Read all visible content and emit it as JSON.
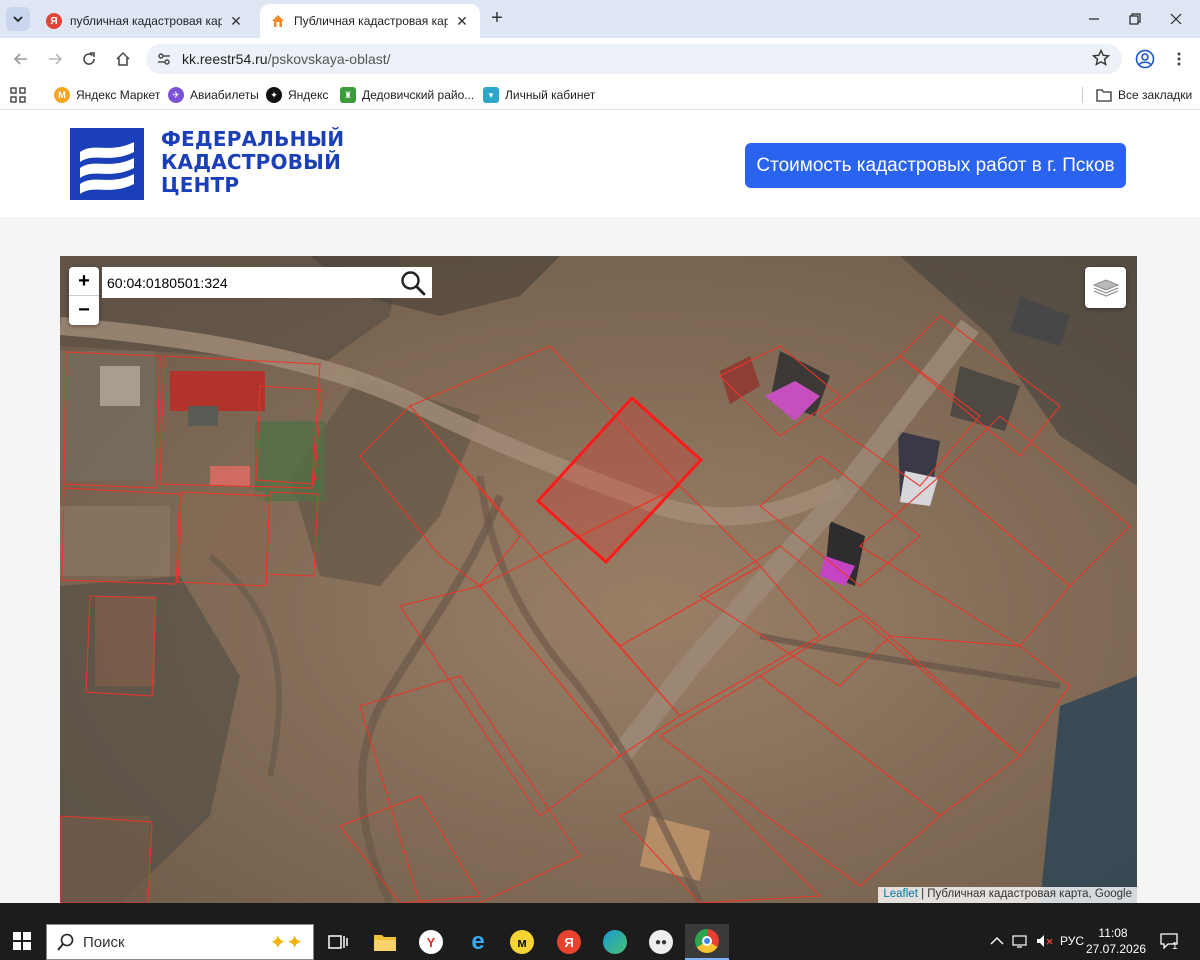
{
  "browser": {
    "tabs": [
      {
        "title": "публичная кадастровая карта",
        "favicon": "yandex-icon",
        "active": false
      },
      {
        "title": "Публичная кадастровая карта",
        "favicon": "house-icon",
        "active": true
      }
    ],
    "new_tab_label": "+",
    "address": {
      "host": "kk.reestr54.ru",
      "path": "/pskovskaya-oblast/"
    }
  },
  "bookmarks": {
    "items": [
      {
        "label": "Яндекс Маркет",
        "icon": "yandex-market-icon"
      },
      {
        "label": "Авиабилеты",
        "icon": "airplane-icon"
      },
      {
        "label": "Яндекс",
        "icon": "yandex-icon"
      },
      {
        "label": "Дедовичский райо...",
        "icon": "coat-of-arms-icon"
      },
      {
        "label": "Личный кабинет",
        "icon": "cabinet-icon"
      }
    ],
    "all_bookmarks": "Все закладки"
  },
  "site": {
    "logo_lines": [
      "ФЕДЕРАЛЬНЫЙ",
      "КАДАСТРОВЫЙ",
      "ЦЕНТР"
    ],
    "cta_label": "Стоимость кадастровых работ в г. Псков",
    "brand_color": "#1a3fb8",
    "cta_color": "#2a63f0"
  },
  "map": {
    "zoom_in": "+",
    "zoom_out": "−",
    "search_value": "60:04:0180501:324",
    "attribution_link": "Leaflet",
    "attribution_rest": " | Публичная кадастровая карта, Google",
    "parcel_outline_color": "#e8362a",
    "selected_parcel_color": "#ff2020"
  },
  "taskbar": {
    "search_placeholder": "Поиск",
    "language": "РУС",
    "time": "11:08",
    "date": "27.07.2026",
    "notifications": "1"
  }
}
